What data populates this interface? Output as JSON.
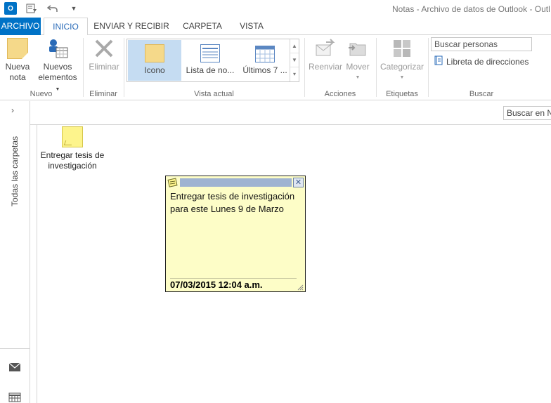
{
  "window": {
    "title": "Notas - Archivo de datos de Outlook - Outl",
    "app_logo": "O"
  },
  "qat": {
    "send_receive_icon": "send-receive-icon",
    "undo_icon": "undo-icon",
    "customize_icon": "customize-qat-icon"
  },
  "tabs": [
    {
      "label": "ARCHIVO"
    },
    {
      "label": "INICIO"
    },
    {
      "label": "ENVIAR Y RECIBIR"
    },
    {
      "label": "CARPETA"
    },
    {
      "label": "VISTA"
    }
  ],
  "ribbon": {
    "nuevo": {
      "group_label": "Nuevo",
      "nueva_nota_line1": "Nueva",
      "nueva_nota_line2": "nota",
      "nuevos_line1": "Nuevos",
      "nuevos_line2": "elementos"
    },
    "eliminar": {
      "group_label": "Eliminar",
      "button_label": "Eliminar"
    },
    "vista_actual": {
      "group_label": "Vista actual",
      "items": [
        {
          "label": "Icono",
          "selected": true
        },
        {
          "label": "Lista de no..."
        },
        {
          "label": "Últimos 7 ..."
        }
      ]
    },
    "acciones": {
      "group_label": "Acciones",
      "reenviar": "Reenviar",
      "mover": "Mover"
    },
    "etiquetas": {
      "group_label": "Etiquetas",
      "categorizar": "Categorizar"
    },
    "buscar": {
      "group_label": "Buscar",
      "search_people_placeholder": "Buscar personas",
      "address_book": "Libreta de direcciones"
    }
  },
  "folder_pane": {
    "label": "Todas las carpetas",
    "expand_icon": "chevron-right-icon"
  },
  "search_notes": {
    "placeholder": "Buscar en No"
  },
  "notes": [
    {
      "icon_label": "Entregar tesis de investigación"
    }
  ],
  "sticky": {
    "body": "Entregar tesis de investigación para este Lunes 9 de Marzo",
    "timestamp": "07/03/2015 12:04 a.m."
  },
  "colors": {
    "accent": "#0072c6",
    "note_yellow": "#fdfdc7",
    "gallery_selected": "#c5dcf2"
  }
}
